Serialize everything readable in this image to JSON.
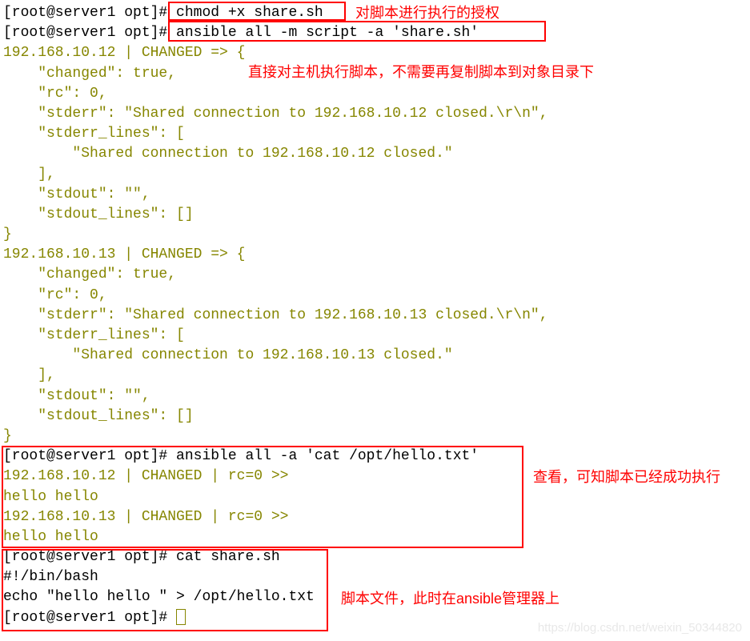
{
  "prompt": "[root@server1 opt]# ",
  "cmd1": "chmod +x share.sh",
  "note1": "对脚本进行执行的授权",
  "cmd2": "ansible all -m script -a 'share.sh'",
  "note2": "直接对主机执行脚本，不需要再复制脚本到对象目录下",
  "out1": {
    "l1": "192.168.10.12 | CHANGED => {",
    "l2": "    \"changed\": true, ",
    "l3": "    \"rc\": 0, ",
    "l4": "    \"stderr\": \"Shared connection to 192.168.10.12 closed.\\r\\n\", ",
    "l5": "    \"stderr_lines\": [",
    "l6": "        \"Shared connection to 192.168.10.12 closed.\"",
    "l7": "    ], ",
    "l8": "    \"stdout\": \"\", ",
    "l9": "    \"stdout_lines\": []",
    "l10": "}"
  },
  "out2": {
    "l1": "192.168.10.13 | CHANGED => {",
    "l2": "    \"changed\": true, ",
    "l3": "    \"rc\": 0, ",
    "l4": "    \"stderr\": \"Shared connection to 192.168.10.13 closed.\\r\\n\", ",
    "l5": "    \"stderr_lines\": [",
    "l6": "        \"Shared connection to 192.168.10.13 closed.\"",
    "l7": "    ], ",
    "l8": "    \"stdout\": \"\", ",
    "l9": "    \"stdout_lines\": []",
    "l10": "}"
  },
  "cmd3": "ansible all -a 'cat /opt/hello.txt'",
  "cat1": {
    "l1": "192.168.10.12 | CHANGED | rc=0 >>",
    "l2": "hello hello ",
    "l3": "192.168.10.13 | CHANGED | rc=0 >>",
    "l4": "hello hello "
  },
  "note3": "查看，可知脚本已经成功执行",
  "cmd4": "cat share.sh",
  "script": {
    "l1": "#!/bin/bash",
    "l2": "echo \"hello hello \" > /opt/hello.txt"
  },
  "note4": "脚本文件，此时在ansible管理器上",
  "watermark": "https://blog.csdn.net/weixin_50344820"
}
